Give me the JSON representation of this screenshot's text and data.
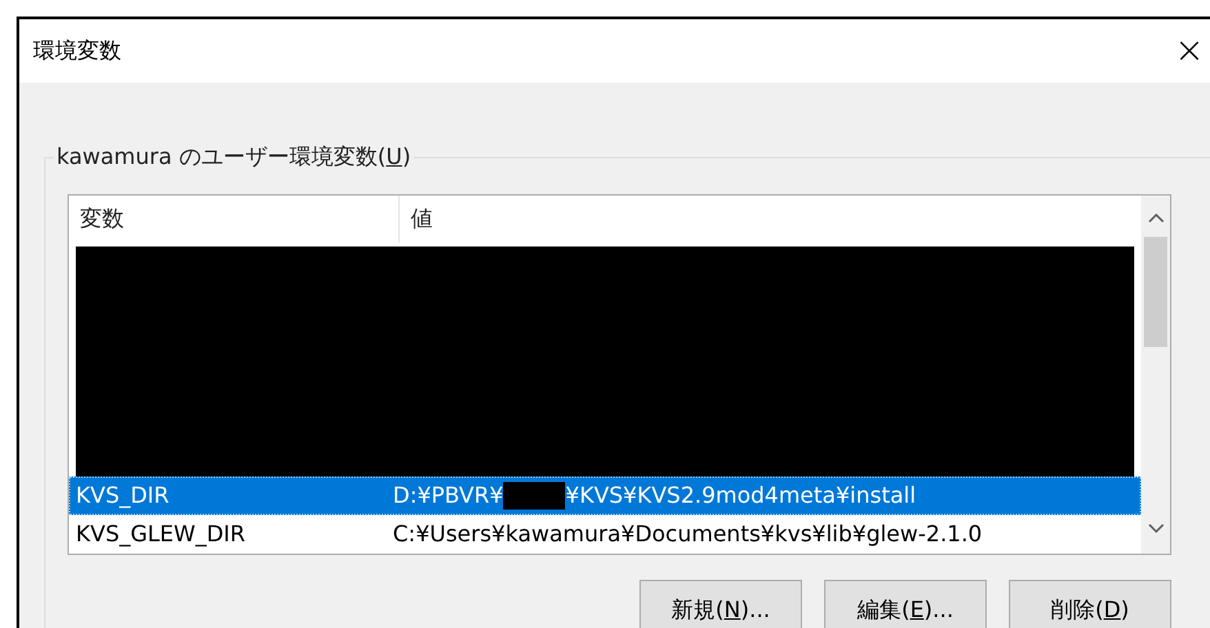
{
  "window": {
    "title": "環境変数",
    "close": "×"
  },
  "group": {
    "before": "kawamura のユーザー環境変数(",
    "key": "U",
    "after": ")"
  },
  "table": {
    "columns": [
      "変数",
      "値"
    ],
    "rows": [
      {
        "kind": "redacted"
      },
      {
        "kind": "row",
        "name": "KVS_DIR",
        "value_before": "D:¥PBVR¥",
        "redacted": true,
        "value_after": "¥KVS¥KVS2.9mod4meta¥install",
        "selected": true
      },
      {
        "kind": "row",
        "name": "KVS_GLEW_DIR",
        "value_before": "C:¥Users¥kawamura¥Documents¥kvs¥lib¥glew-2.1.0",
        "redacted": false,
        "value_after": "",
        "selected": false
      }
    ]
  },
  "buttons": [
    {
      "before": "新規(",
      "key": "N",
      "after": ")..."
    },
    {
      "before": "編集(",
      "key": "E",
      "after": ")..."
    },
    {
      "before": "削除(",
      "key": "D",
      "after": ")"
    }
  ]
}
